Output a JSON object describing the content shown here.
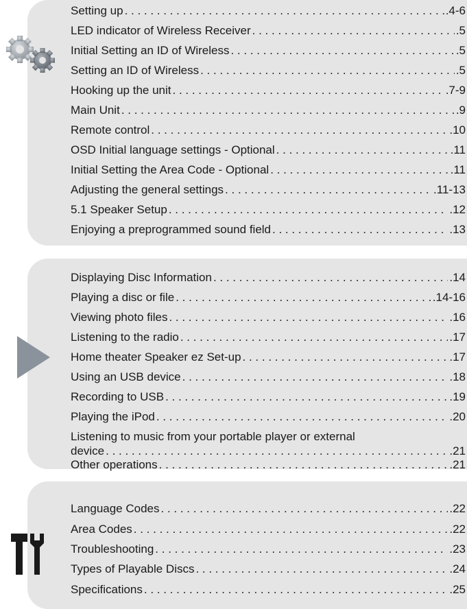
{
  "sections": [
    {
      "icon": "gears-icon",
      "entries": [
        {
          "label": "Setting up",
          "page": ".4-6"
        },
        {
          "label": "LED indicator of Wireless Receiver",
          "page": ".5"
        },
        {
          "label": "Initial Setting an ID of Wireless",
          "page": ".5"
        },
        {
          "label": "Setting an ID of Wireless",
          "page": ".5"
        },
        {
          "label": "Hooking up the unit",
          "page": ".7-9"
        },
        {
          "label": "Main Unit",
          "page": ".9"
        },
        {
          "label": "Remote control",
          "page": ".10"
        },
        {
          "label": "OSD Initial language settings - Optional",
          "page": ".11"
        },
        {
          "label": "Initial Setting the Area Code - Optional",
          "page": ".11"
        },
        {
          "label": "Adjusting the general settings",
          "page": ".11-13"
        },
        {
          "label": "5.1 Speaker Setup",
          "page": ".12"
        },
        {
          "label": "Enjoying a preprogrammed sound field",
          "page": ".13"
        }
      ]
    },
    {
      "icon": "play-icon",
      "entries": [
        {
          "label": "Displaying Disc Information",
          "page": ".14"
        },
        {
          "label": "Playing a disc or file",
          "page": ".14-16"
        },
        {
          "label": "Viewing photo files",
          "page": ".16"
        },
        {
          "label": "Listening to the radio",
          "page": ".17"
        },
        {
          "label": "Home theater Speaker ez Set-up",
          "page": ".17"
        },
        {
          "label": "Using an USB device",
          "page": ".18"
        },
        {
          "label": "Recording to USB",
          "page": ".19"
        },
        {
          "label": "Playing the iPod",
          "page": ".20"
        },
        {
          "label_line1": "Listening to music from your portable player or external",
          "label": "device",
          "page": ".21"
        },
        {
          "label": "Other operations",
          "page": ".21"
        }
      ]
    },
    {
      "icon": "tools-icon",
      "entries": [
        {
          "label": "Language Codes",
          "page": ".22"
        },
        {
          "label": "Area Codes",
          "page": ".22"
        },
        {
          "label": "Troubleshooting",
          "page": ".23"
        },
        {
          "label": "Types of Playable Discs",
          "page": ".24"
        },
        {
          "label": "Specifications",
          "page": ".25"
        }
      ]
    }
  ]
}
